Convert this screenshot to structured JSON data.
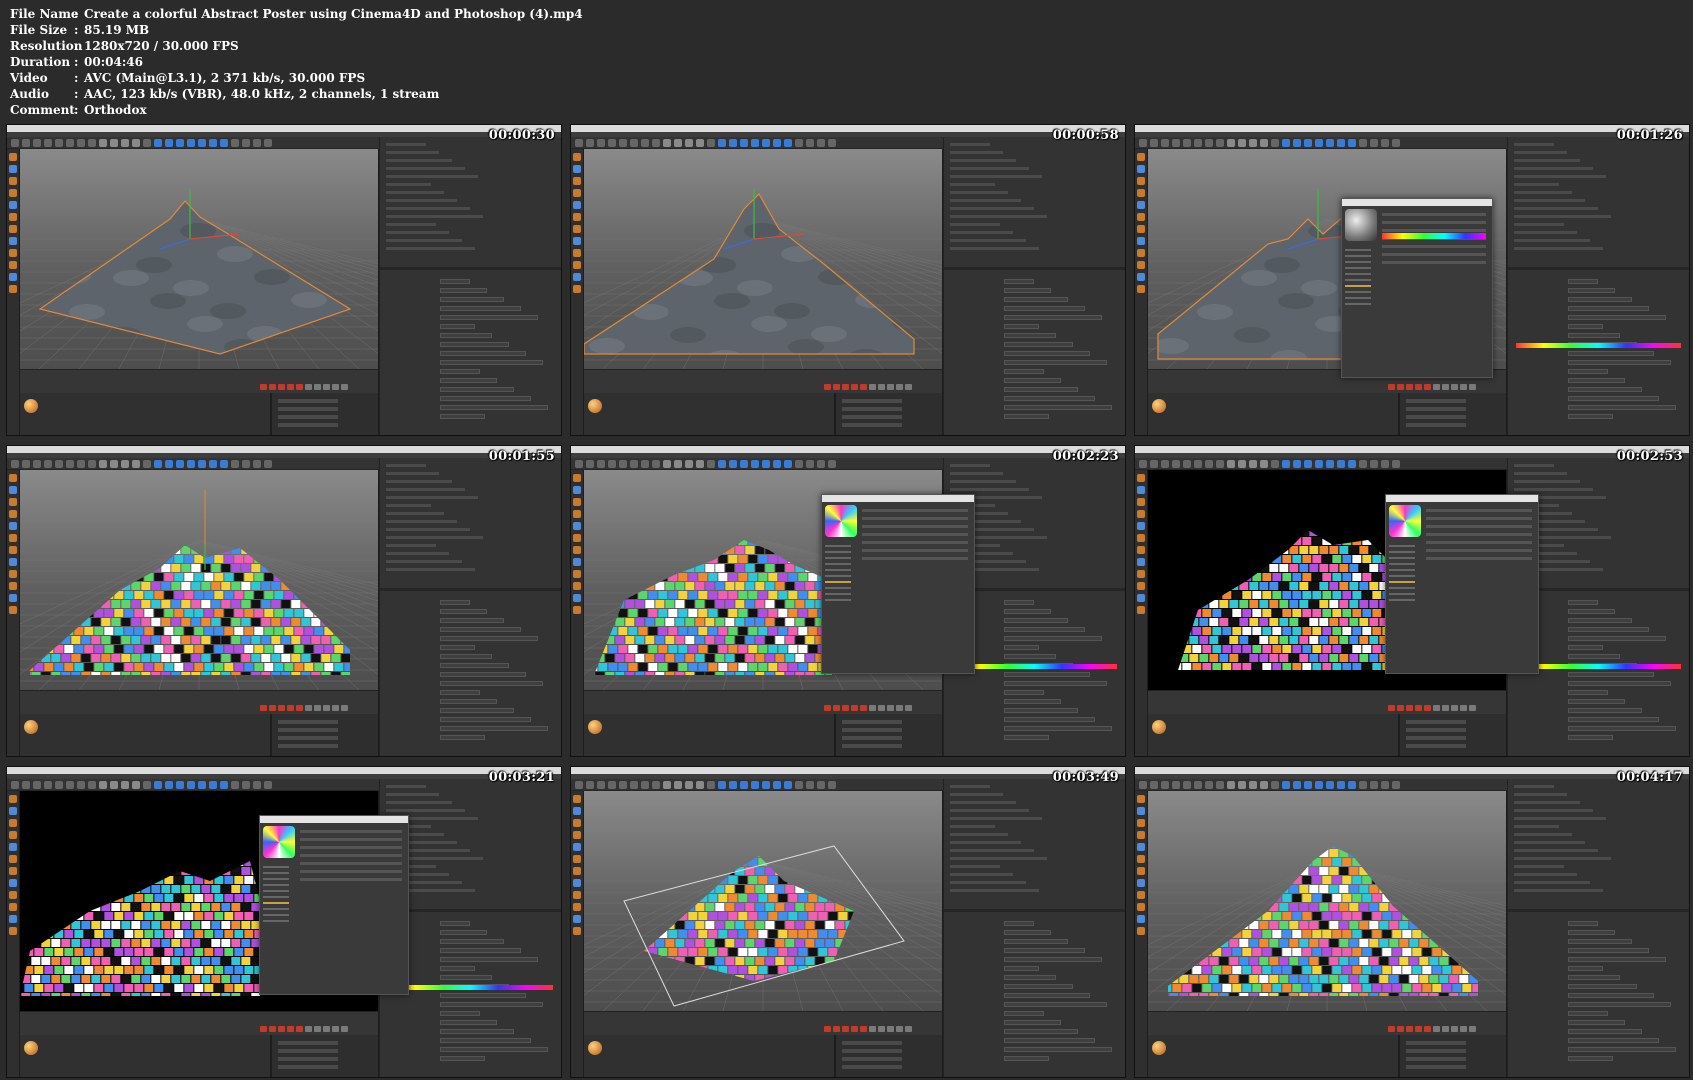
{
  "info": {
    "rows": [
      {
        "key": "File Name",
        "sep": ":",
        "value": "Create a colorful Abstract Poster using Cinema4D and Photoshop (4).mp4"
      },
      {
        "key": "File Size",
        "sep": ":",
        "value": "85.19 MB"
      },
      {
        "key": "Resolution",
        "sep": ":",
        "value": "1280x720 / 30.000 FPS"
      },
      {
        "key": "Duration",
        "sep": ":",
        "value": "00:04:46"
      },
      {
        "key": "Video",
        "sep": ":",
        "value": "AVC (Main@L3.1), 2 371 kb/s, 30.000 FPS"
      },
      {
        "key": "Audio",
        "sep": ":",
        "value": "AAC, 123 kb/s (VBR), 48.0 kHz, 2 channels, 1 stream"
      },
      {
        "key": "Comment",
        "sep": ":",
        "value": "Orthodox"
      }
    ]
  },
  "thumbnails": [
    {
      "timecode": "00:00:30",
      "scene": "gray-mountain",
      "editor": "none"
    },
    {
      "timecode": "00:00:58",
      "scene": "gray-peak",
      "editor": "none"
    },
    {
      "timecode": "00:01:26",
      "scene": "gray-mountain-ridge",
      "editor": "gray-material"
    },
    {
      "timecode": "00:01:55",
      "scene": "colored-mountain",
      "editor": "none"
    },
    {
      "timecode": "00:02:23",
      "scene": "colored-blocks",
      "editor": "color-material"
    },
    {
      "timecode": "00:02:53",
      "scene": "colored-blocks-dark",
      "editor": "color-material"
    },
    {
      "timecode": "00:03:21",
      "scene": "colored-blocks-dark-wide",
      "editor": "color-material"
    },
    {
      "timecode": "00:03:49",
      "scene": "colored-plane-perspective",
      "editor": "none"
    },
    {
      "timecode": "00:04:17",
      "scene": "colored-mountain-peak",
      "editor": "none"
    }
  ],
  "colors": {
    "background": "#2b2b2b",
    "viewport_gray": "#6e6e6e",
    "mountain_gray": "#5d646b",
    "selection_orange": "#e08a3a",
    "accent_pink": "#f05fb4",
    "accent_cyan": "#2fc6d8",
    "accent_yellow": "#f2d43a"
  }
}
